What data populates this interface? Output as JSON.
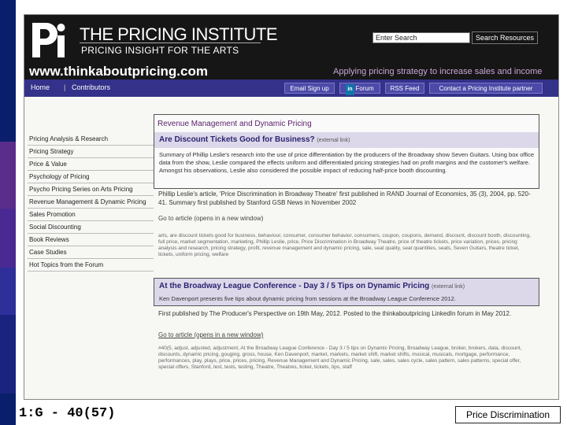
{
  "site": {
    "title": "THE PRICING INSTITUTE",
    "subtitle": "PRICING INSIGHT FOR THE ARTS",
    "url": "www.thinkaboutpricing.com",
    "tagline": "Applying pricing strategy to increase sales and income",
    "search_placeholder": "Enter Search",
    "search_button": "Search Resources"
  },
  "nav": {
    "home": "Home",
    "sep": "|",
    "contributors": "Contributors",
    "email": "Email Sign up",
    "forum_badge": "in",
    "forum": "Forum",
    "rss": "RSS Feed",
    "contact": "Contact a Pricing Institute partner"
  },
  "sidebar": {
    "items": [
      "Pricing Analysis & Research",
      "Pricing Strategy",
      "Price & Value",
      "Psychology of Pricing",
      "Psycho Pricing Series on Arts Pricing",
      "Revenue Management & Dynamic Pricing",
      "Sales Promotion",
      "Social Discounting",
      "Book Reviews",
      "Case Studies",
      "Hot Topics from the Forum"
    ]
  },
  "article1": {
    "section_title": "Revenue Management and Dynamic Pricing",
    "title": "Are Discount Tickets Good for Business?",
    "external": "(external link)",
    "summary": "Summary of Phillip Leslie's research into the use of price differentiation by the producers of the Broadway show Seven Guitars. Using box office data from the show, Leslie compared the effects uniform and differentiated pricing strategies had on profit margins and the customer's welfare. Amongst his observations, Leslie also considered the possible impact of reducing half-price booth discounting.",
    "published": "Phillip Leslie's article, 'Price Discrimination in Broadway Theatre' first published in RAND Journal of Economics, 35 (3), 2004, pp. 520-41. Summary first published by Stanford GSB News in November 2002",
    "goto": "Go to article (opens in a new window)",
    "tags": "arts, are discount tickets good for business, behaviour, consumer, consumer behavior, consumers, coupon, coupons, demand, discount, discount booth, discounting, full price, market segmentation, marketing, Phillip Leslie, price, Price Discrimination in Broadway Theatre, price of theatre tickets, price variation, prices, pricing analysis and research, pricing strategy, profit, revenue management and dynamic pricing, sale, seat quality, seat quantities, seats, Seven Guitars, theatre ticket, tickets, uniform pricing, welfare"
  },
  "article2": {
    "title": "At the Broadway League Conference - Day 3 / 5 Tips on Dynamic Pricing",
    "external": "(external link)",
    "summary": "Ken Davenport presents five tips about dynamic pricing from sessions at the Broadway League Conference 2012.",
    "published": "First published by The Producer's Perspective on 19th May, 2012. Posted to the thinkaboutpricing LinkedIn forum in May 2012.",
    "goto": "Go to article (opens in a new window)",
    "tags": "#40(5, adjust, adjusted, adjustment, At the Broadway League Conference - Day 3 / 5 tips on Dynamic Pricing, Broadway League, broker, brokers, data, discount, discounts, dynamic pricing, gouging, gross, house, Ken Davenport, market, markets, market shift, market shifts, musical, musicals, mortgage, performance, performances, play, plays, price, prices, pricing, Revenue Management and Dynamic Pricing, sale, sales, sales cycle, sales pattern, sales patterns, special offer, special offers, Stanford, test, tests, testing, Theatre, Theatres, ticket, tickets, tips, staff"
  },
  "slide": {
    "label": "1:G - 40(57)",
    "caption": "Price Discrimination"
  }
}
